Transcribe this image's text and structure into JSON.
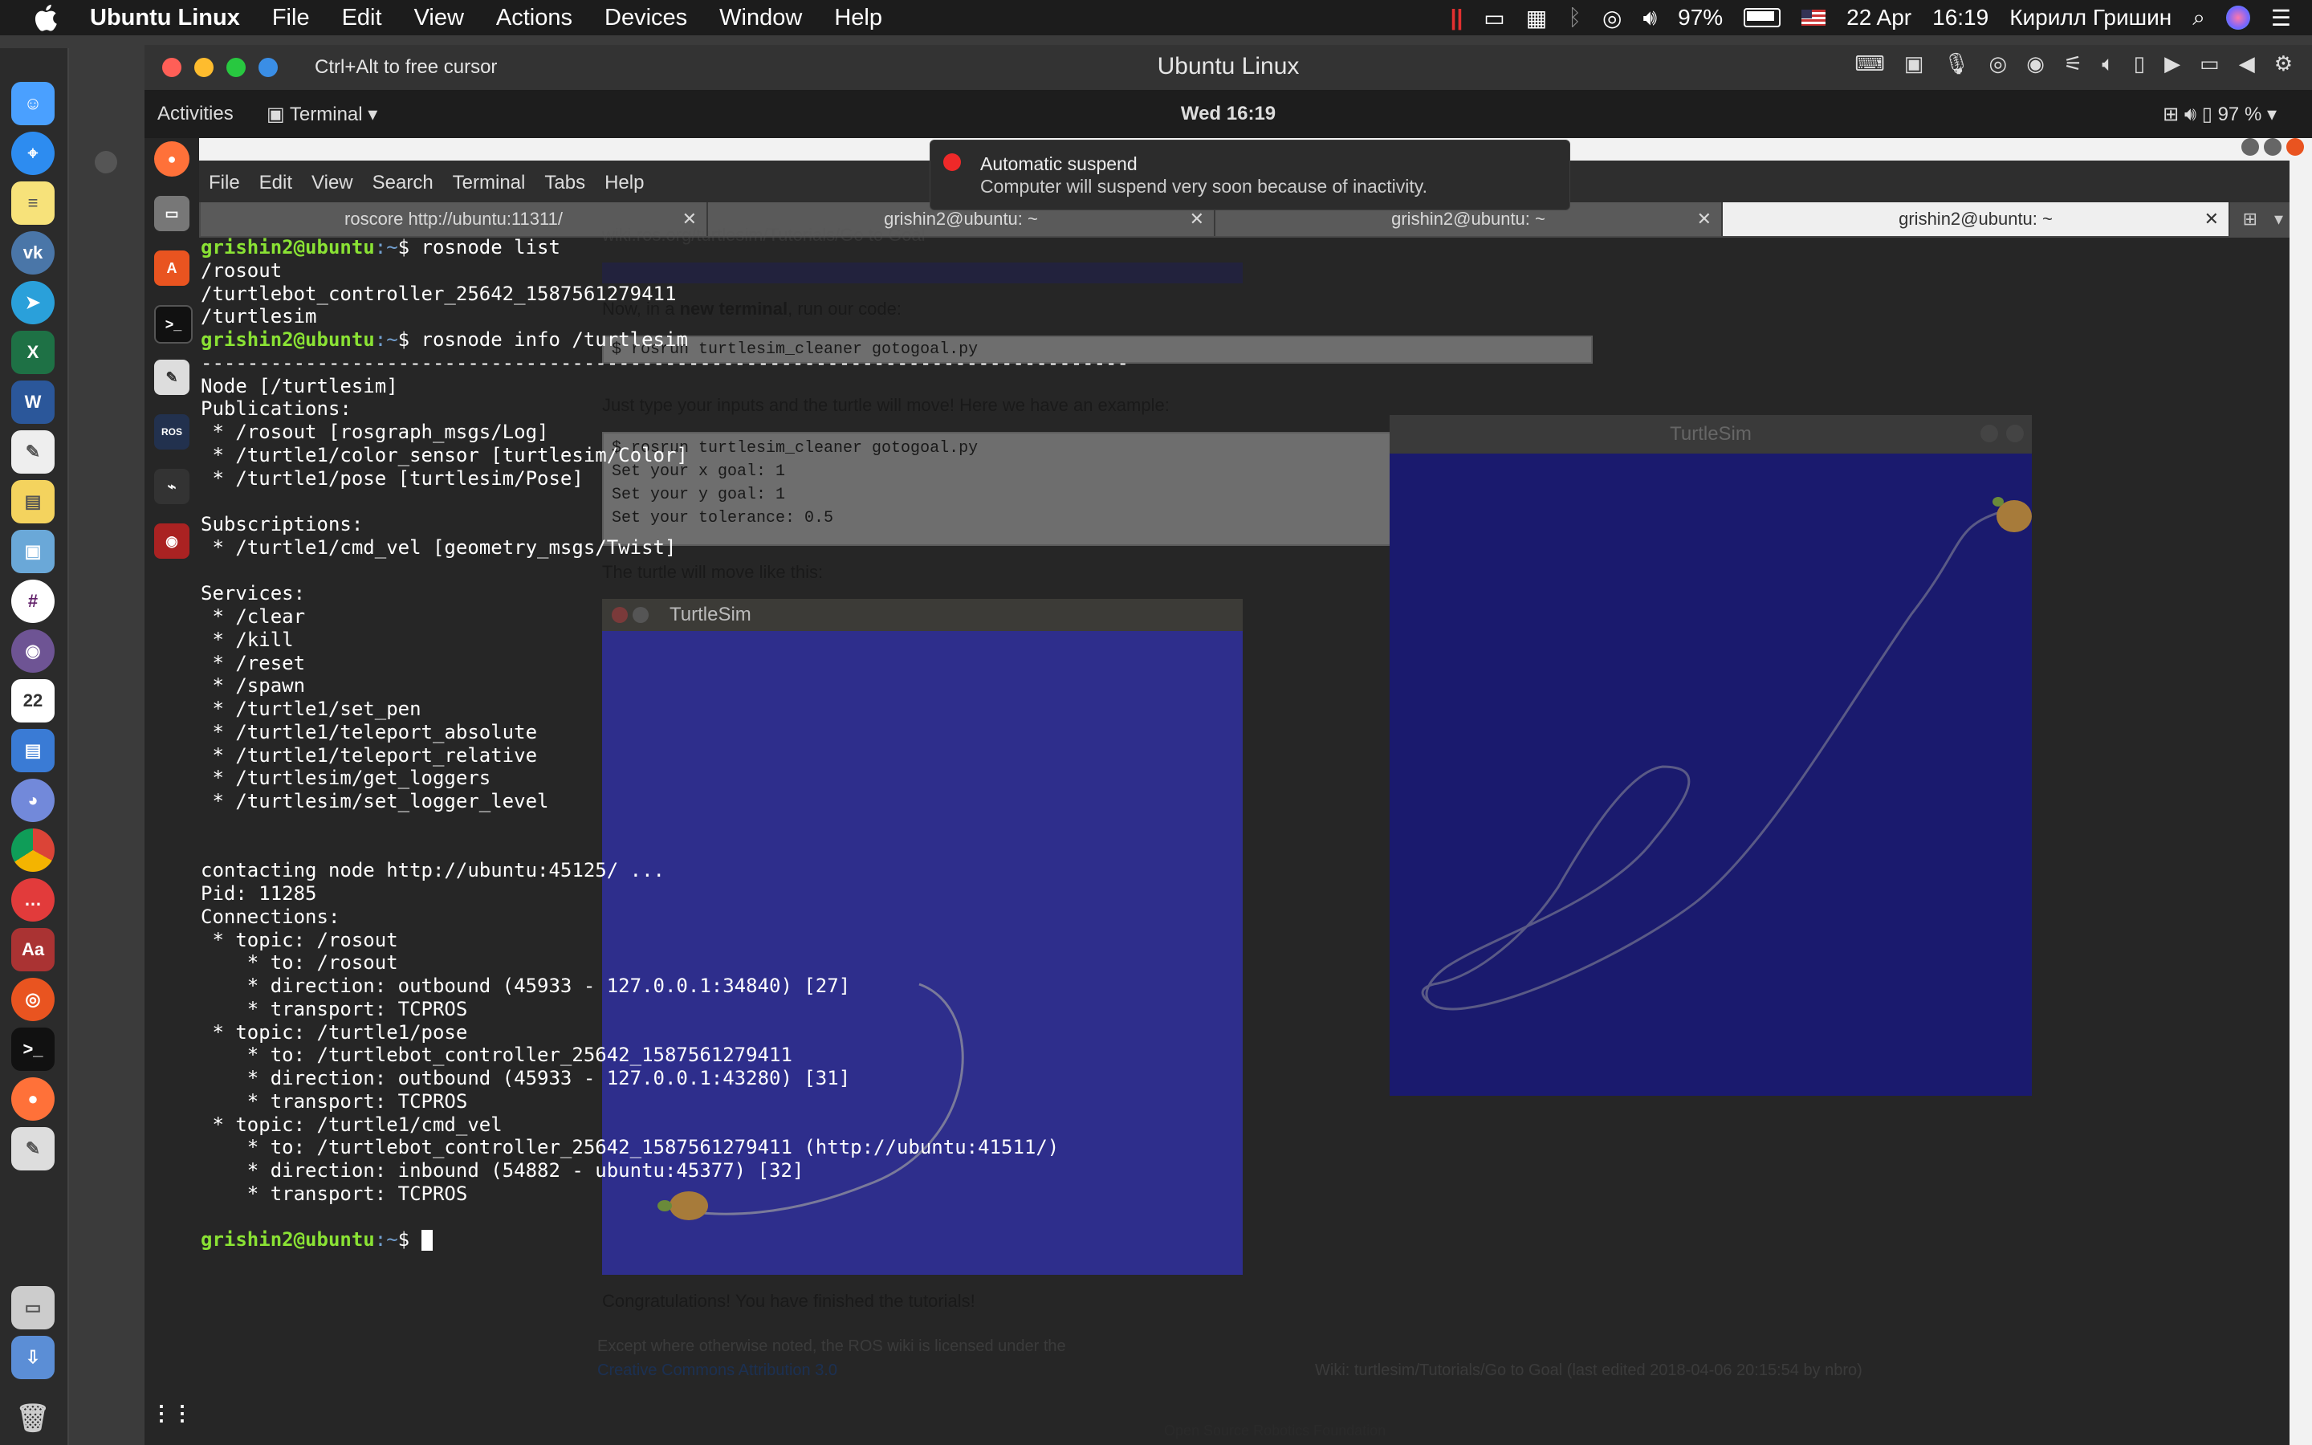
{
  "mac_menubar": {
    "app_name": "Ubuntu Linux",
    "menu_items": [
      "File",
      "Edit",
      "View",
      "Actions",
      "Devices",
      "Window",
      "Help"
    ],
    "battery": "97%",
    "date": "22 Apr",
    "time": "16:19",
    "user": "Кирилл Гришин"
  },
  "vm_window": {
    "hint": "Ctrl+Alt to free cursor",
    "title": "Ubuntu Linux"
  },
  "ubuntu_topbar": {
    "activities": "Activities",
    "app_menu": "Terminal",
    "clock": "Wed 16:19",
    "battery": "97 %"
  },
  "notification": {
    "title": "Automatic suspend",
    "body": "Computer will suspend very soon because of inactivity."
  },
  "terminal": {
    "menu": [
      "File",
      "Edit",
      "View",
      "Search",
      "Terminal",
      "Tabs",
      "Help"
    ],
    "tabs": [
      {
        "label": "roscore http://ubuntu:11311/"
      },
      {
        "label": "grishin2@ubuntu: ~"
      },
      {
        "label": "grishin2@ubuntu: ~"
      },
      {
        "label": "grishin2@ubuntu: ~"
      }
    ],
    "prompt": "grishin2@ubuntu",
    "lines": {
      "cmd1": "$ rosnode list",
      "out1": "/rosout\n/turtlebot_controller_25642_1587561279411\n/turtlesim",
      "cmd2": "$ rosnode info /turtlesim",
      "out2": "--------------------------------------------------------------------------------\nNode [/turtlesim]\nPublications: \n * /rosout [rosgraph_msgs/Log]\n * /turtle1/color_sensor [turtlesim/Color]\n * /turtle1/pose [turtlesim/Pose]\n\nSubscriptions: \n * /turtle1/cmd_vel [geometry_msgs/Twist]\n\nServices: \n * /clear\n * /kill\n * /reset\n * /spawn\n * /turtle1/set_pen\n * /turtle1/teleport_absolute\n * /turtle1/teleport_relative\n * /turtlesim/get_loggers\n * /turtlesim/set_logger_level\n\n\ncontacting node http://ubuntu:45125/ ...\nPid: 11285\nConnections:\n * topic: /rosout\n    * to: /rosout\n    * direction: outbound (45933 - 127.0.0.1:34840) [27]\n    * transport: TCPROS\n * topic: /turtle1/pose\n    * to: /turtlebot_controller_25642_1587561279411\n    * direction: outbound (45933 - 127.0.0.1:43280) [31]\n    * transport: TCPROS\n * topic: /turtle1/cmd_vel\n    * to: /turtlebot_controller_25642_1587561279411 (http://ubuntu:41511/)\n    * direction: inbound (54882 - ubuntu:45377) [32]\n    * transport: TCPROS\n",
      "cmd3": "$ "
    }
  },
  "browser_overlay": {
    "url": "wiki.ros.org/turtlesim/Tutorials/Go to Goal",
    "p1_pre": "Now, in a ",
    "p1_bold": "new terminal",
    "p1_post": ", run our code:",
    "code1": "$ rosrun turtlesim_cleaner gotogoal.py",
    "p2": "Just type your inputs and the turtle will move! Here we have an example:",
    "code2": "$ rosrun turtlesim_cleaner gotogoal.py\nSet your x goal: 1\nSet your y goal: 1\nSet your tolerance: 0.5",
    "p3": "The turtle will move like this:",
    "turtlesim_title": "TurtleSim",
    "p4": "Congratulations! You have finished the tutorials!",
    "footer1": "Except where otherwise noted, the ROS wiki is licensed under the",
    "footer_link": "Creative Commons Attribution 3.0",
    "footer_right": "Wiki: turtlesim/Tutorials/Go to Goal (last edited 2018-04-06 20:15:54 by nbro)",
    "brand": "Open Source Robotics Foundation"
  },
  "turtlesim_window": {
    "title": "TurtleSim"
  },
  "colors": {
    "prompt_green": "#8ae234",
    "terminal_bg": "#262626",
    "turtle_bg": "#1a1a6e"
  }
}
